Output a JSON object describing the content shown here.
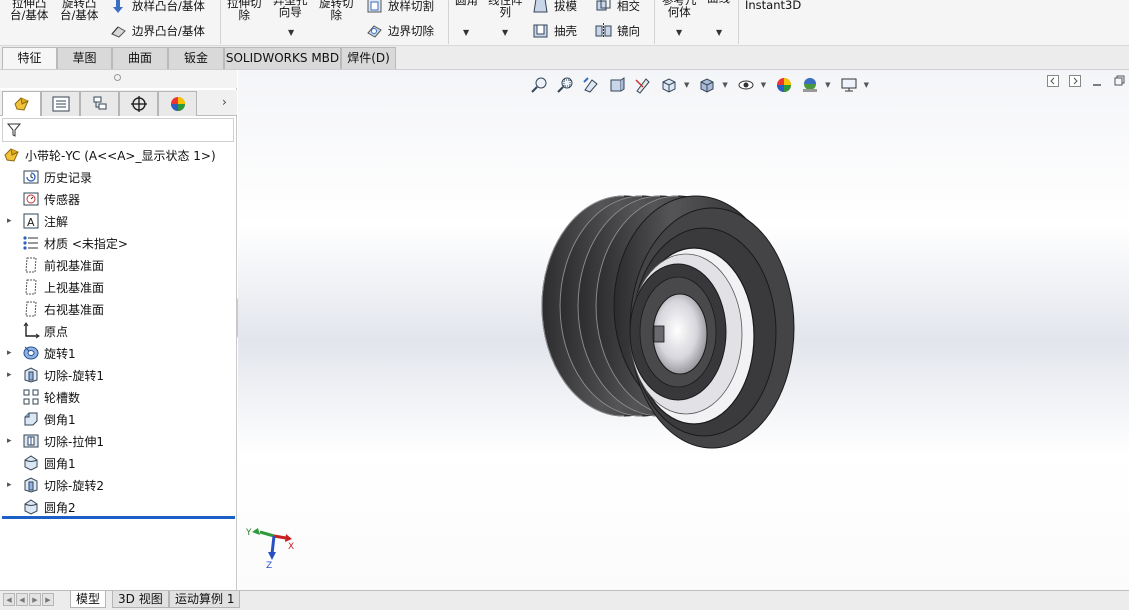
{
  "ribbon": {
    "extrude_boss": "拉伸凸\n台/基体",
    "revolve_boss": "旋转凸\n台/基体",
    "loft_boss": "放样凸台/基体",
    "boundary_boss": "边界凸台/基体",
    "extrude_cut": "拉伸切\n除",
    "hole_wizard": "异型孔\n向导",
    "revolve_cut": "旋转切\n除",
    "loft_cut": "放样切割",
    "boundary_cut": "边界切除",
    "fillet": "圆角",
    "linear_pattern": "线性阵\n列",
    "draft": "拔模",
    "shell": "抽壳",
    "intersect": "相交",
    "mirror": "镜向",
    "ref_geometry": "参考几\n何体",
    "curves": "曲线",
    "instant3d": "Instant3D"
  },
  "tabs": [
    "特征",
    "草图",
    "曲面",
    "钣金",
    "SOLIDWORKS MBD",
    "焊件(D)"
  ],
  "active_tab": "特征",
  "tree": {
    "root": "小带轮-YC  (A<<A>_显示状态 1>)",
    "items": [
      {
        "label": "历史记录",
        "icon": "history-icon",
        "expandable": false
      },
      {
        "label": "传感器",
        "icon": "sensor-icon",
        "expandable": false
      },
      {
        "label": "注解",
        "icon": "annotation-icon",
        "expandable": true
      },
      {
        "label": "材质 <未指定>",
        "icon": "material-icon",
        "expandable": false
      },
      {
        "label": "前视基准面",
        "icon": "plane-icon",
        "expandable": false
      },
      {
        "label": "上视基准面",
        "icon": "plane-icon",
        "expandable": false
      },
      {
        "label": "右视基准面",
        "icon": "plane-icon",
        "expandable": false
      },
      {
        "label": "原点",
        "icon": "origin-icon",
        "expandable": false
      },
      {
        "label": "旋转1",
        "icon": "revolve-icon",
        "expandable": true
      },
      {
        "label": "切除-旋转1",
        "icon": "cut-revolve-icon",
        "expandable": true
      },
      {
        "label": "轮槽数",
        "icon": "pattern-icon",
        "expandable": false
      },
      {
        "label": "倒角1",
        "icon": "chamfer-icon",
        "expandable": false
      },
      {
        "label": "切除-拉伸1",
        "icon": "cut-extrude-icon",
        "expandable": true
      },
      {
        "label": "圆角1",
        "icon": "fillet-icon",
        "expandable": false
      },
      {
        "label": "切除-旋转2",
        "icon": "cut-revolve-icon",
        "expandable": true
      },
      {
        "label": "圆角2",
        "icon": "fillet-icon",
        "expandable": false
      }
    ]
  },
  "triad": {
    "x": "X",
    "y": "Y",
    "z": "Z"
  },
  "bottom_tabs": [
    "模型",
    "3D 视图",
    "运动算例 1"
  ],
  "active_bottom_tab": "模型",
  "colors": {
    "part": "#4a4a4c",
    "part_dark": "#2e2e30",
    "highlight": "#1c5fc6",
    "tab_active": "#f6f6f6"
  }
}
